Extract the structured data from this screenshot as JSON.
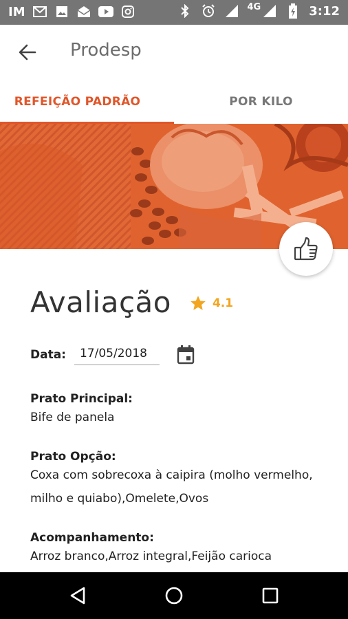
{
  "status_bar": {
    "left_label": "IM",
    "icons_left": [
      "gmail-icon",
      "photo-icon",
      "mail-icon",
      "youtube-icon",
      "instagram-icon"
    ],
    "icons_right": [
      "bluetooth-icon",
      "alarm-icon",
      "signal-icon",
      "wifi-signal-icon",
      "battery-icon"
    ],
    "network": "4G",
    "time": "3:12"
  },
  "app_bar": {
    "title": "Prodesp",
    "back_icon": "arrow-back-icon"
  },
  "tabs": [
    {
      "label": "REFEIÇÃO PADRÃO",
      "active": true
    },
    {
      "label": "POR KILO",
      "active": false
    }
  ],
  "hero": {
    "image": "food-photo"
  },
  "fab": {
    "icon": "thumbs-up-icon"
  },
  "evaluation": {
    "title": "Avaliação",
    "rating": "4.1",
    "star_icon": "star-icon"
  },
  "date": {
    "label": "Data:",
    "value": "17/05/2018",
    "calendar_icon": "calendar-icon"
  },
  "sections": [
    {
      "label": "Prato Principal:",
      "text": "Bife de panela"
    },
    {
      "label": "Prato Opção:",
      "text": "Coxa com sobrecoxa à caipira (molho vermelho, milho e quiabo),Omelete,Ovos"
    },
    {
      "label": "Acompanhamento:",
      "text": "Arroz branco,Arroz integral,Feijão carioca"
    }
  ],
  "colors": {
    "accent": "#e0562a",
    "star": "#f2a51e",
    "status_bar": "#757575",
    "nav_bar": "#000000"
  },
  "nav_bar": {
    "back": "nav-back-icon",
    "home": "nav-home-icon",
    "recents": "nav-recents-icon"
  }
}
